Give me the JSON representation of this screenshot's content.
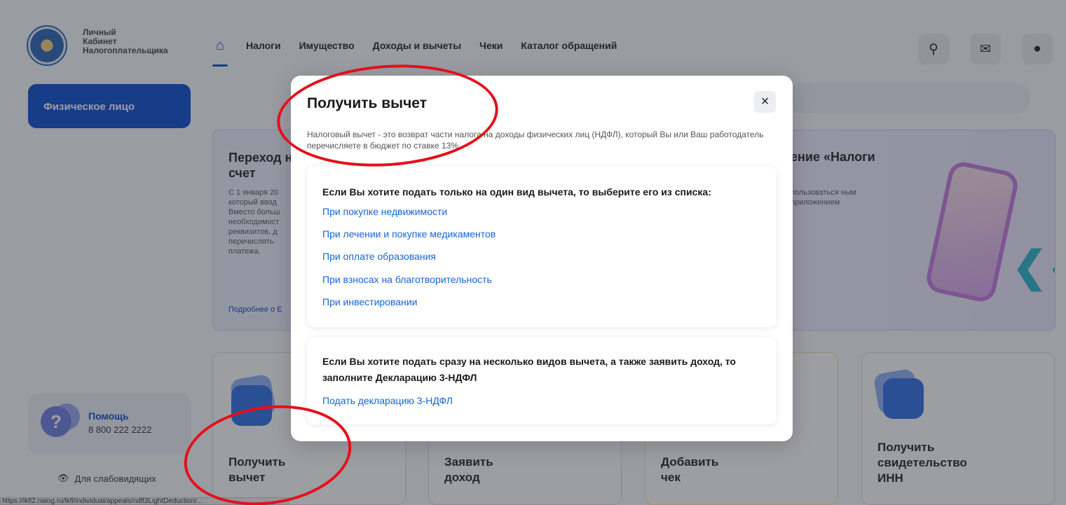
{
  "header": {
    "logo_text": [
      "Личный",
      "Кабинет",
      "Налогоплательщика"
    ],
    "nav": [
      "Налоги",
      "Имущество",
      "Доходы и вычеты",
      "Чеки",
      "Каталог обращений"
    ],
    "icons": {
      "home": "home-icon",
      "search": "search-icon",
      "mail": "mail-icon",
      "profile": "profile-icon"
    }
  },
  "sidebar": {
    "person_type": "Физическое лицо",
    "help_title": "Помощь",
    "help_phone": "8 800 222 2222",
    "low_vision": "Для слабовидящих"
  },
  "banner": {
    "title": "Переход на",
    "title2": "счет",
    "text": "С 1 января 20 который ввод Вместо больш необходимост реквизитов, д перечислять платежа.",
    "link": "Подробнее о Е",
    "right_title": "ение «Налоги",
    "right_text": "пользоваться ным приложением"
  },
  "tiles": [
    {
      "line1": "Получить",
      "line2": "вычет"
    },
    {
      "line1": "Заявить",
      "line2": "доход"
    },
    {
      "line1": "Добавить",
      "line2": "чек"
    },
    {
      "line1": "Получить",
      "line2": "свидетельство",
      "line3": "ИНН"
    }
  ],
  "statusbar": "https://lkfl2.nalog.ru/lkfl/individual/appeals/ndfl3LightDeduction/...",
  "modal": {
    "title": "Получить вычет",
    "close": "×",
    "description": "Налоговый вычет - это возврат части налога на доходы физических лиц (НДФЛ), который Вы или Ваш работодатель перечисляете в бюджет по ставке 13%.",
    "single": {
      "heading": "Если Вы хотите подать только на один вид вычета, то выберите его из списка:",
      "options": [
        "При покупке недвижимости",
        "При лечении и покупке медикаментов",
        "При оплате образования",
        "При взносах на благотворительность",
        "При инвестировании"
      ]
    },
    "multi": {
      "heading": "Если Вы хотите подать сразу на несколько видов вычета, а также заявить доход, то заполните Декларацию 3-НДФЛ",
      "link": "Подать декларацию 3-НДФЛ"
    }
  },
  "colors": {
    "accent": "#0a4bd0",
    "link": "#1565d8",
    "annotation": "#e5101a"
  }
}
